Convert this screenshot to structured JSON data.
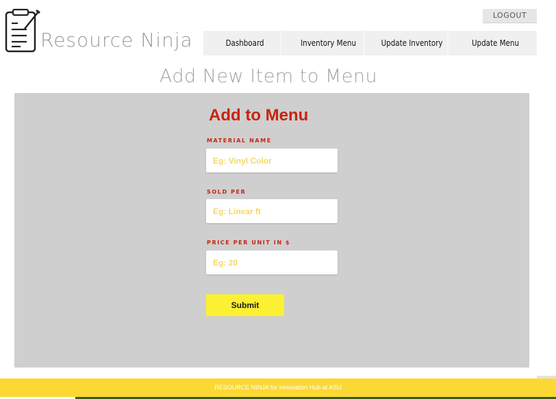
{
  "header": {
    "brand": "Resource Ninja",
    "logo_icon": "clipboard-checklist-icon",
    "logout_label": "LOGOUT"
  },
  "nav": {
    "items": [
      {
        "label": "Dashboard"
      },
      {
        "label": "Inventory Menu"
      },
      {
        "label": "Update Inventory"
      },
      {
        "label": "Update Menu"
      }
    ]
  },
  "page": {
    "title": "Add New Item to Menu"
  },
  "form": {
    "title": "Add to Menu",
    "fields": [
      {
        "label": "MATERIAL NAME",
        "placeholder": "Eg: Vinyl Color",
        "value": ""
      },
      {
        "label": "SOLD PER",
        "placeholder": "Eg: Linear ft",
        "value": ""
      },
      {
        "label": "PRICE PER UNIT IN $",
        "placeholder": "Eg: 20",
        "value": ""
      }
    ],
    "submit_label": "Submit"
  },
  "footer": {
    "text": "RESOURCE NINJA for Innovation Hub at ASU"
  },
  "colors": {
    "accent_red": "#c8230f",
    "button_yellow": "#fbf032",
    "footer_yellow": "#fcd833",
    "panel_gray": "#cfcfcf",
    "placeholder_yellow": "#f3d96a"
  }
}
